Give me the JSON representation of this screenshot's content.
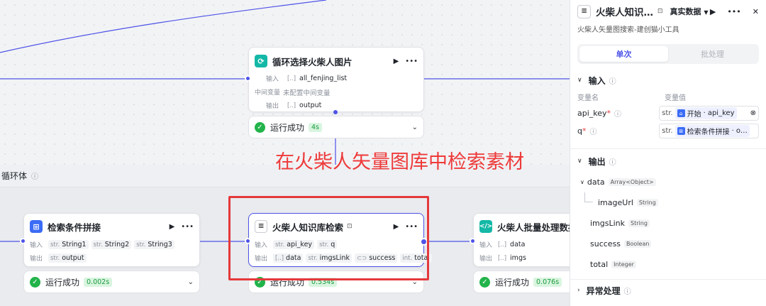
{
  "loop_header": {
    "title": "循环体",
    "info_icon": "info-icon"
  },
  "loop_node": {
    "title": "循环选择火柴人图片",
    "input_label": "输入",
    "input_value": "all_fenjing_list",
    "var_label": "中间变量",
    "var_value": "未配置中间变量",
    "output_label": "输出",
    "output_value": "output",
    "status": "运行成功",
    "time": "4s"
  },
  "concat_node": {
    "title": "检索条件拼接",
    "input_label": "输入",
    "inputs": [
      "String1",
      "String2",
      "String3"
    ],
    "output_label": "输出",
    "output_value": "output",
    "status": "运行成功",
    "time": "0.002s"
  },
  "search_node": {
    "title": "火柴人知识库检索",
    "input_label": "输入",
    "inputs": [
      "api_key",
      "q"
    ],
    "output_label": "输出",
    "outputs": [
      "data",
      "imgsLink",
      "success",
      "total"
    ],
    "status": "运行成功",
    "time": "0.534s"
  },
  "batch_node": {
    "title": "火柴人批量处理数据检",
    "input_label": "输入",
    "input_value": "data",
    "output_label": "输出",
    "output_value": "imgs",
    "status": "运行成功",
    "time": "0.076s"
  },
  "annotation": "在火柴人矢量图库中检索素材",
  "type_tags": {
    "str": "str.",
    "arr": "[..]",
    "bool": "⊂⊃",
    "int": "int."
  },
  "panel": {
    "title": "火柴人知识…",
    "mode": "真实数据",
    "description": "火柴人矢量图搜索-建创猫小工具",
    "tabs": [
      "单次",
      "批处理"
    ],
    "input_section": "输入",
    "col_name": "变量名",
    "col_value": "变量值",
    "params": [
      {
        "name": "api_key",
        "type": "str.",
        "ref_node": "开始",
        "ref_var": "api_key"
      },
      {
        "name": "q",
        "type": "str.",
        "ref_node": "检索条件拼接",
        "ref_var": "o…"
      }
    ],
    "output_section": "输出",
    "outputs": [
      {
        "name": "data",
        "type": "Array<Object>"
      },
      {
        "name": "imageUrl",
        "type": "String"
      },
      {
        "name": "imgsLink",
        "type": "String"
      },
      {
        "name": "success",
        "type": "Boolean"
      },
      {
        "name": "total",
        "type": "Integer"
      }
    ],
    "error_section": "异常处理"
  },
  "colors": {
    "accent": "#4d53e8",
    "success": "#22b34a",
    "annotation": "#ee3a3a",
    "teal": "#14b8a6",
    "blue": "#3b6cf6"
  }
}
